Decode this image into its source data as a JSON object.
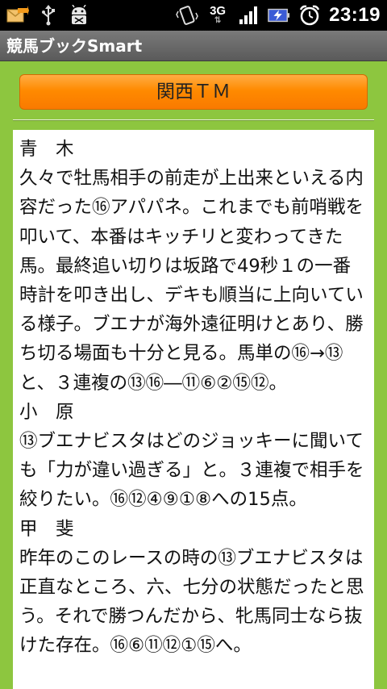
{
  "status_bar": {
    "time": "23:19",
    "network": "3G",
    "icons": [
      "mail-arrow-icon",
      "usb-icon",
      "android-debug-icon",
      "vibrate-icon",
      "network-3g-icon",
      "signal-icon",
      "battery-charging-icon",
      "alarm-icon"
    ]
  },
  "app": {
    "title": "競馬ブックSmart"
  },
  "header": {
    "button_label": "関西ＴＭ"
  },
  "comments": [
    {
      "name": "青　木",
      "text": "久々で牡馬相手の前走が上出来といえる内容だった⑯アパパネ。これまでも前哨戦を叩いて、本番はキッチリと変わってきた馬。最終追い切りは坂路で49秒１の一番時計を叩き出し、デキも順当に上向いている様子。ブエナが海外遠征明けとあり、勝ち切る場面も十分と見る。馬単の⑯→⑬と、３連複の⑬⑯―⑪⑥②⑮⑫。"
    },
    {
      "name": "小　原",
      "text": "⑬ブエナビスタはどのジョッキーに聞いても「力が違い過ぎる」と。３連複で相手を絞りたい。⑯⑫④⑨①⑧への15点。"
    },
    {
      "name": "甲　斐",
      "text": "昨年のこのレースの時の⑬ブエナビスタは正直なところ、六、七分の状態だったと思う。それで勝つんだから、牝馬同士なら抜けた存在。⑯⑥⑪⑫①⑮へ。"
    }
  ],
  "colors": {
    "background": "#8dc63f",
    "accent": "#ff8a00"
  }
}
